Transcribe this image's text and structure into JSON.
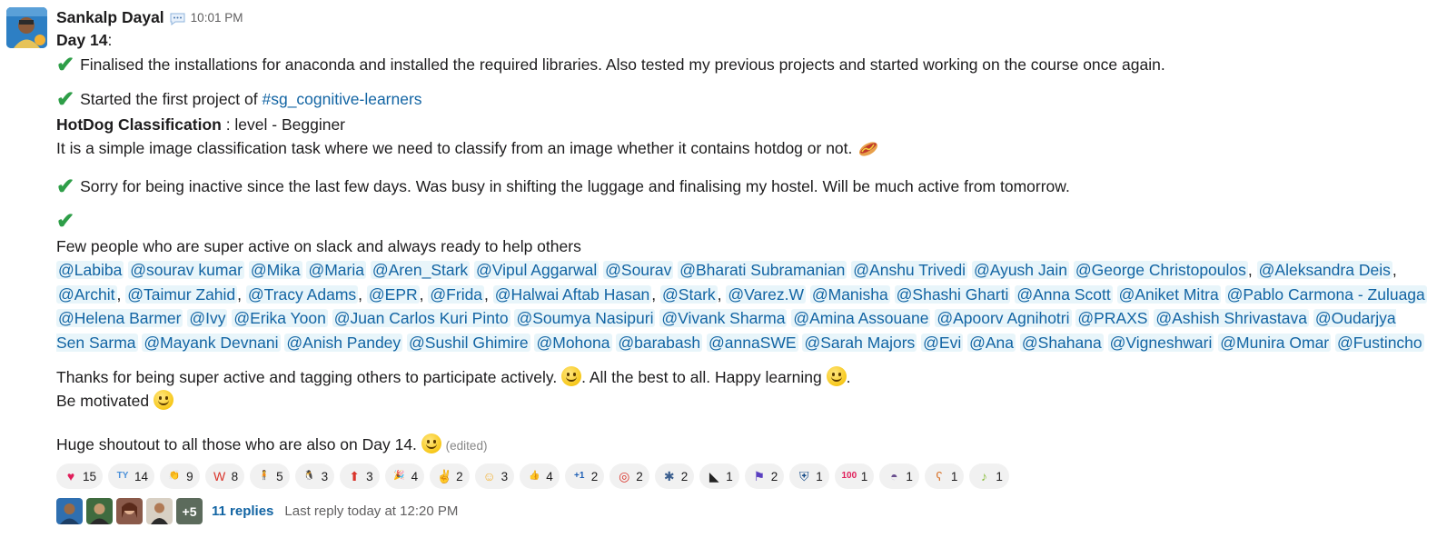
{
  "message": {
    "author": "Sankalp Dayal",
    "time": "10:01 PM",
    "day_label": "Day 14",
    "day_colon": ":",
    "line1": "Finalised the installations for anaconda and installed the required libraries. Also tested my previous projects and started working on the course once again.",
    "line2_prefix": "Started the first project of ",
    "channel": "#sg_cognitive-learners",
    "project_title": "HotDog Classification",
    "project_level": " : level - Begginer",
    "project_desc": "It is a simple image classification task where we need to classify from an image whether it contains hotdog or not.",
    "line3": "Sorry for being inactive since the last few days. Was busy in shifting the luggage and finalising my hostel. Will be much active from tomorrow.",
    "few_people": "Few people who are super active on slack and always ready to help others",
    "mentions": [
      "@Labiba",
      "@sourav kumar",
      "@Mika",
      "@Maria",
      "@Aren_Stark",
      "@Vipul Aggarwal",
      "@Sourav",
      "@Bharati Subramanian",
      "@Anshu Trivedi",
      "@Ayush Jain",
      "@George Christopoulos",
      "@Aleksandra Deis",
      "@Archit",
      "@Taimur Zahid",
      "@Tracy Adams",
      "@EPR",
      "@Frida",
      "@Halwai Aftab Hasan",
      "@Stark",
      "@Varez.W",
      "@Manisha",
      "@Shashi Gharti",
      "@Anna Scott",
      "@Aniket Mitra",
      "@Pablo Carmona - Zuluaga",
      "@Helena Barmer",
      "@Ivy",
      "@Erika Yoon",
      "@Juan Carlos Kuri Pinto",
      "@Soumya Nasipuri",
      "@Vivank Sharma",
      "@Amina Assouane",
      "@Apoorv Agnihotri",
      "@PRAXS",
      "@Ashish Shrivastava",
      "@Oudarjya Sen Sarma",
      "@Mayank Devnani",
      "@Anish Pandey",
      "@Sushil Ghimire",
      "@Mohona",
      "@barabash",
      "@annaSWE",
      "@Sarah Majors",
      "@Evi",
      "@Ana",
      "@Shahana",
      "@Vigneshwari",
      "@Munira Omar",
      "@Fustincho"
    ],
    "thanks_a": "Thanks for being super active and tagging others to participate actively. ",
    "thanks_b": ". All the best to all. Happy learning ",
    "thanks_c": ".",
    "be_motivated": "Be motivated ",
    "shoutout": "Huge shoutout to all those who are also on Day 14. ",
    "edited": "(edited)"
  },
  "reactions": [
    {
      "icon": "heart-icon",
      "glyph": "♥",
      "color": "#e01e5a",
      "count": "15"
    },
    {
      "icon": "thank-you-icon",
      "glyph": "TY",
      "color": "#4a90d9",
      "count": "14"
    },
    {
      "icon": "clapping-hands-icon",
      "glyph": "👏",
      "color": "#e8a04a",
      "count": "9"
    },
    {
      "icon": "w-badge-icon",
      "glyph": "W",
      "color": "#d9342b",
      "count": "8"
    },
    {
      "icon": "person-icon",
      "glyph": "🧍",
      "color": "#444444",
      "count": "5"
    },
    {
      "icon": "penguin-icon",
      "glyph": "🐧",
      "color": "#333333",
      "count": "3"
    },
    {
      "icon": "upvote-icon",
      "glyph": "⬆",
      "color": "#d9342b",
      "count": "3"
    },
    {
      "icon": "party-popper-icon",
      "glyph": "🎉",
      "color": "#e8a04a",
      "count": "4"
    },
    {
      "icon": "victory-hand-icon",
      "glyph": "✌",
      "color": "#f2b134",
      "count": "2"
    },
    {
      "icon": "smiley-icon",
      "glyph": "☺",
      "color": "#f2b134",
      "count": "3"
    },
    {
      "icon": "thumbs-up-icon",
      "glyph": "👍",
      "color": "#f2b134",
      "count": "4"
    },
    {
      "icon": "plus-one-icon",
      "glyph": "+1",
      "color": "#1d5fb5",
      "count": "2"
    },
    {
      "icon": "target-icon",
      "glyph": "◎",
      "color": "#d9342b",
      "count": "2"
    },
    {
      "icon": "parrot-icon",
      "glyph": "✱",
      "color": "#3b5f8f",
      "count": "2"
    },
    {
      "icon": "ninja-icon",
      "glyph": "◣",
      "color": "#222222",
      "count": "1"
    },
    {
      "icon": "flag-runner-icon",
      "glyph": "⚑",
      "color": "#5a3fc0",
      "count": "2"
    },
    {
      "icon": "shield-icon",
      "glyph": "⛨",
      "color": "#1b4f8a",
      "count": "1"
    },
    {
      "icon": "hundred-icon",
      "glyph": "100",
      "color": "#e01e5a",
      "count": "1"
    },
    {
      "icon": "hat-icon",
      "glyph": "◓",
      "color": "#6a4f8f",
      "count": "1"
    },
    {
      "icon": "bear-icon",
      "glyph": "ʕ",
      "color": "#d9742b",
      "count": "1"
    },
    {
      "icon": "dancing-banana-icon",
      "glyph": "♪",
      "color": "#8cbf3f",
      "count": "1"
    }
  ],
  "thread": {
    "more_avatars": "+5",
    "replies": "11 replies",
    "last_reply": "Last reply today at 12:20 PM"
  }
}
